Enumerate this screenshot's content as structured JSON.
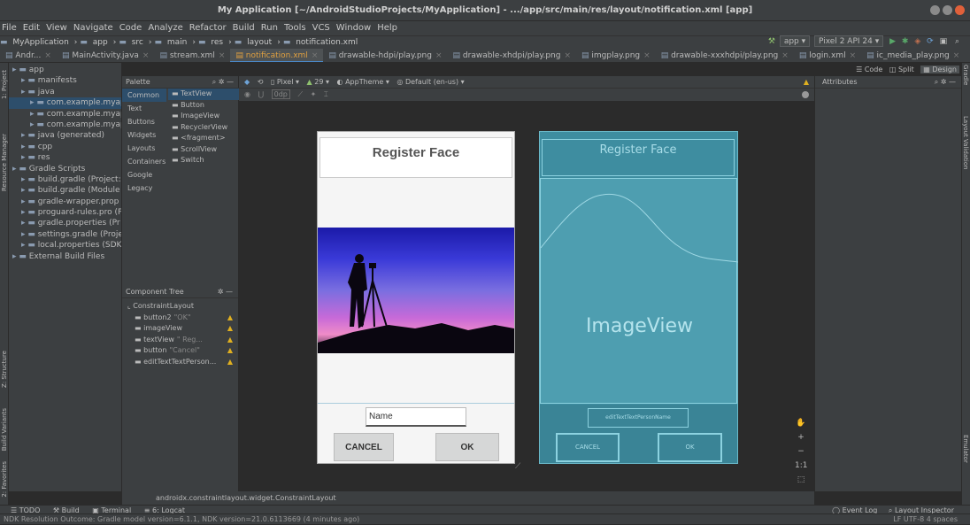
{
  "window": {
    "title": "My Application [~/AndroidStudioProjects/MyApplication] - .../app/src/main/res/layout/notification.xml [app]"
  },
  "menu": [
    "File",
    "Edit",
    "View",
    "Navigate",
    "Code",
    "Analyze",
    "Refactor",
    "Build",
    "Run",
    "Tools",
    "VCS",
    "Window",
    "Help"
  ],
  "nav": {
    "crumbs": [
      "MyApplication",
      "app",
      "src",
      "main",
      "res",
      "layout",
      "notification.xml"
    ],
    "run_config": "app",
    "device": "Pixel 2 API 24"
  },
  "editor_tabs": [
    {
      "label": "Andr...",
      "active": false
    },
    {
      "label": "MainActivity.java",
      "active": false
    },
    {
      "label": "stream.xml",
      "active": false
    },
    {
      "label": "notification.xml",
      "active": true
    },
    {
      "label": "drawable-hdpi/play.png",
      "active": false
    },
    {
      "label": "drawable-xhdpi/play.png",
      "active": false
    },
    {
      "label": "imgplay.png",
      "active": false
    },
    {
      "label": "drawable-xxxhdpi/play.png",
      "active": false
    },
    {
      "label": "login.xml",
      "active": false
    },
    {
      "label": "ic_media_play.png",
      "active": false
    }
  ],
  "view_modes": [
    "Code",
    "Split",
    "Design"
  ],
  "project_tree": [
    {
      "label": "app",
      "indent": 0,
      "sel": false,
      "dim": false
    },
    {
      "label": "manifests",
      "indent": 1,
      "sel": false,
      "dim": false
    },
    {
      "label": "java",
      "indent": 1,
      "sel": false,
      "dim": false
    },
    {
      "label": "com.example.myap",
      "indent": 2,
      "sel": true,
      "dim": false
    },
    {
      "label": "com.example.myap",
      "indent": 2,
      "sel": false,
      "dim": false
    },
    {
      "label": "com.example.myap",
      "indent": 2,
      "sel": false,
      "dim": false
    },
    {
      "label": "java (generated)",
      "indent": 1,
      "sel": false,
      "dim": false
    },
    {
      "label": "cpp",
      "indent": 1,
      "sel": false,
      "dim": false
    },
    {
      "label": "res",
      "indent": 1,
      "sel": false,
      "dim": false
    },
    {
      "label": "Gradle Scripts",
      "indent": 0,
      "sel": false,
      "dim": false
    },
    {
      "label": "build.gradle (Project:",
      "indent": 1,
      "sel": false,
      "dim": false
    },
    {
      "label": "build.gradle (Module",
      "indent": 1,
      "sel": false,
      "dim": false
    },
    {
      "label": "gradle-wrapper.prop",
      "indent": 1,
      "sel": false,
      "dim": false
    },
    {
      "label": "proguard-rules.pro (P",
      "indent": 1,
      "sel": false,
      "dim": false
    },
    {
      "label": "gradle.properties (Pr",
      "indent": 1,
      "sel": false,
      "dim": false
    },
    {
      "label": "settings.gradle (Proje",
      "indent": 1,
      "sel": false,
      "dim": false
    },
    {
      "label": "local.properties (SDK",
      "indent": 1,
      "sel": false,
      "dim": false
    },
    {
      "label": "External Build Files",
      "indent": 0,
      "sel": false,
      "dim": false
    }
  ],
  "palette": {
    "title": "Palette",
    "categories": [
      "Common",
      "Text",
      "Buttons",
      "Widgets",
      "Layouts",
      "Containers",
      "Google",
      "Legacy"
    ],
    "items": [
      "TextView",
      "Button",
      "ImageView",
      "RecyclerView",
      "<fragment>",
      "ScrollView",
      "Switch"
    ]
  },
  "component_tree": {
    "title": "Component Tree",
    "root": "ConstraintLayout",
    "items": [
      {
        "label": "button2",
        "sub": "\"OK\""
      },
      {
        "label": "imageView",
        "sub": ""
      },
      {
        "label": "textView",
        "sub": "\"  Reg..."
      },
      {
        "label": "button",
        "sub": "\"Cancel\""
      },
      {
        "label": "editTextTextPerson...",
        "sub": ""
      }
    ]
  },
  "design_toolbar": {
    "device": "Pixel",
    "api": "29",
    "theme": "AppTheme",
    "locale": "Default (en-us)",
    "margin": "0dp"
  },
  "attributes": {
    "title": "Attributes"
  },
  "phone": {
    "title": "Register Face",
    "name_field": "Name",
    "cancel": "CANCEL",
    "ok": "OK"
  },
  "blueprint": {
    "title": "Register Face",
    "image_label": "ImageView",
    "edit_label": "editTextTextPersonName",
    "cancel": "CANCEL",
    "ok": "OK"
  },
  "breadcrumb": "androidx.constraintlayout.widget.ConstraintLayout",
  "bottom_tabs": [
    "TODO",
    "Build",
    "Terminal",
    "6: Logcat"
  ],
  "bottom_right_tabs": [
    "Event Log",
    "Layout Inspector"
  ],
  "status": {
    "message": "NDK Resolution Outcome: Gradle model version=6.1.1, NDK version=21.0.6113669 (4 minutes ago)",
    "right": "LF  UTF-8  4 spaces"
  },
  "side_tools_left": [
    "1: Project",
    "Resource Manager",
    "Z: Structure",
    "Build Variants",
    "2: Favorites"
  ],
  "side_tools_right": [
    "Gradle",
    "Layout Validation",
    "Emulator"
  ],
  "colors": {
    "accent": "#4a88c7",
    "blueprint": "#3e8da0",
    "warning": "#e0b020"
  }
}
